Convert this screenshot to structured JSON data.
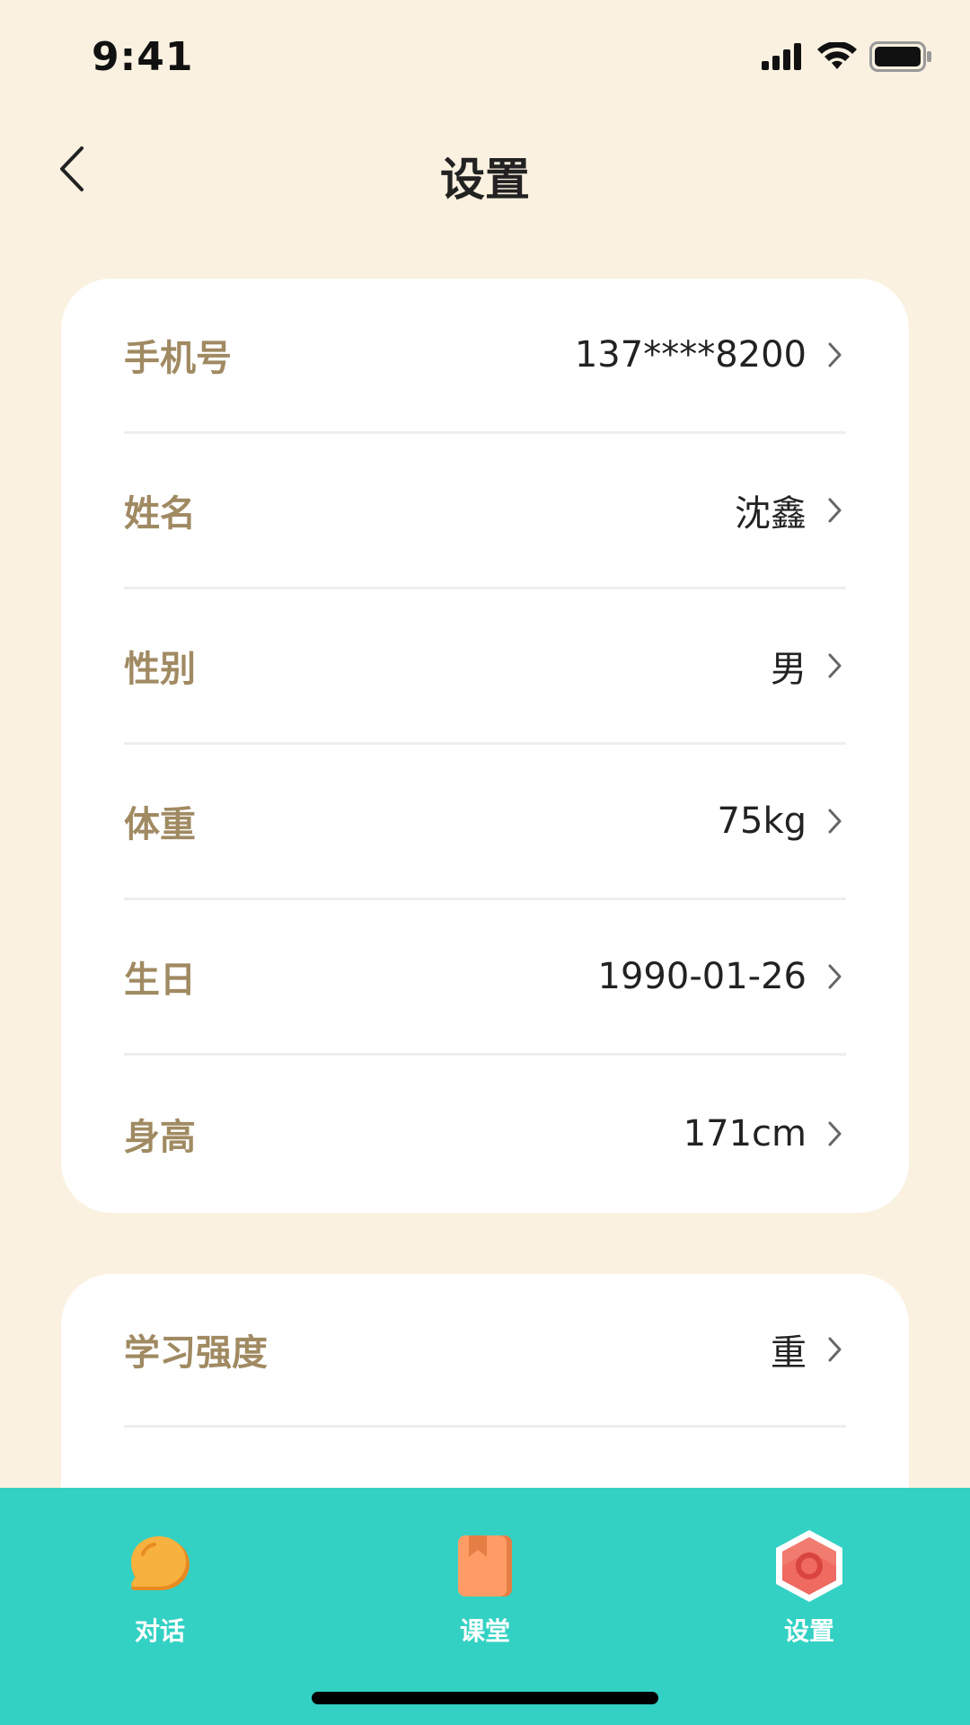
{
  "status_bar": {
    "time": "9:41",
    "icons": [
      "signal-icon",
      "wifi-icon",
      "battery-icon"
    ]
  },
  "header": {
    "title": "设置",
    "back_icon": "chevron-left-icon"
  },
  "profile_card": {
    "rows": [
      {
        "label": "手机号",
        "value": "137****8200"
      },
      {
        "label": "姓名",
        "value": "沈鑫"
      },
      {
        "label": "性别",
        "value": "男"
      },
      {
        "label": "体重",
        "value": "75kg"
      },
      {
        "label": "生日",
        "value": "1990-01-26"
      },
      {
        "label": "身高",
        "value": "171cm"
      }
    ]
  },
  "study_card": {
    "rows": [
      {
        "label": "学习强度",
        "value": "重"
      }
    ]
  },
  "tab_bar": {
    "tabs": [
      {
        "label": "对话",
        "icon": "chat-bubble-icon"
      },
      {
        "label": "课堂",
        "icon": "book-icon"
      },
      {
        "label": "设置",
        "icon": "settings-hex-icon"
      }
    ]
  },
  "colors": {
    "background": "#FAF1E0",
    "card": "#FFFFFF",
    "label": "#A08A62",
    "value": "#222222",
    "tab_bar": "#33D1C3",
    "chat_icon": "#F7A83A",
    "book_icon": "#FF9A62",
    "settings_icon": "#EF6A61"
  }
}
